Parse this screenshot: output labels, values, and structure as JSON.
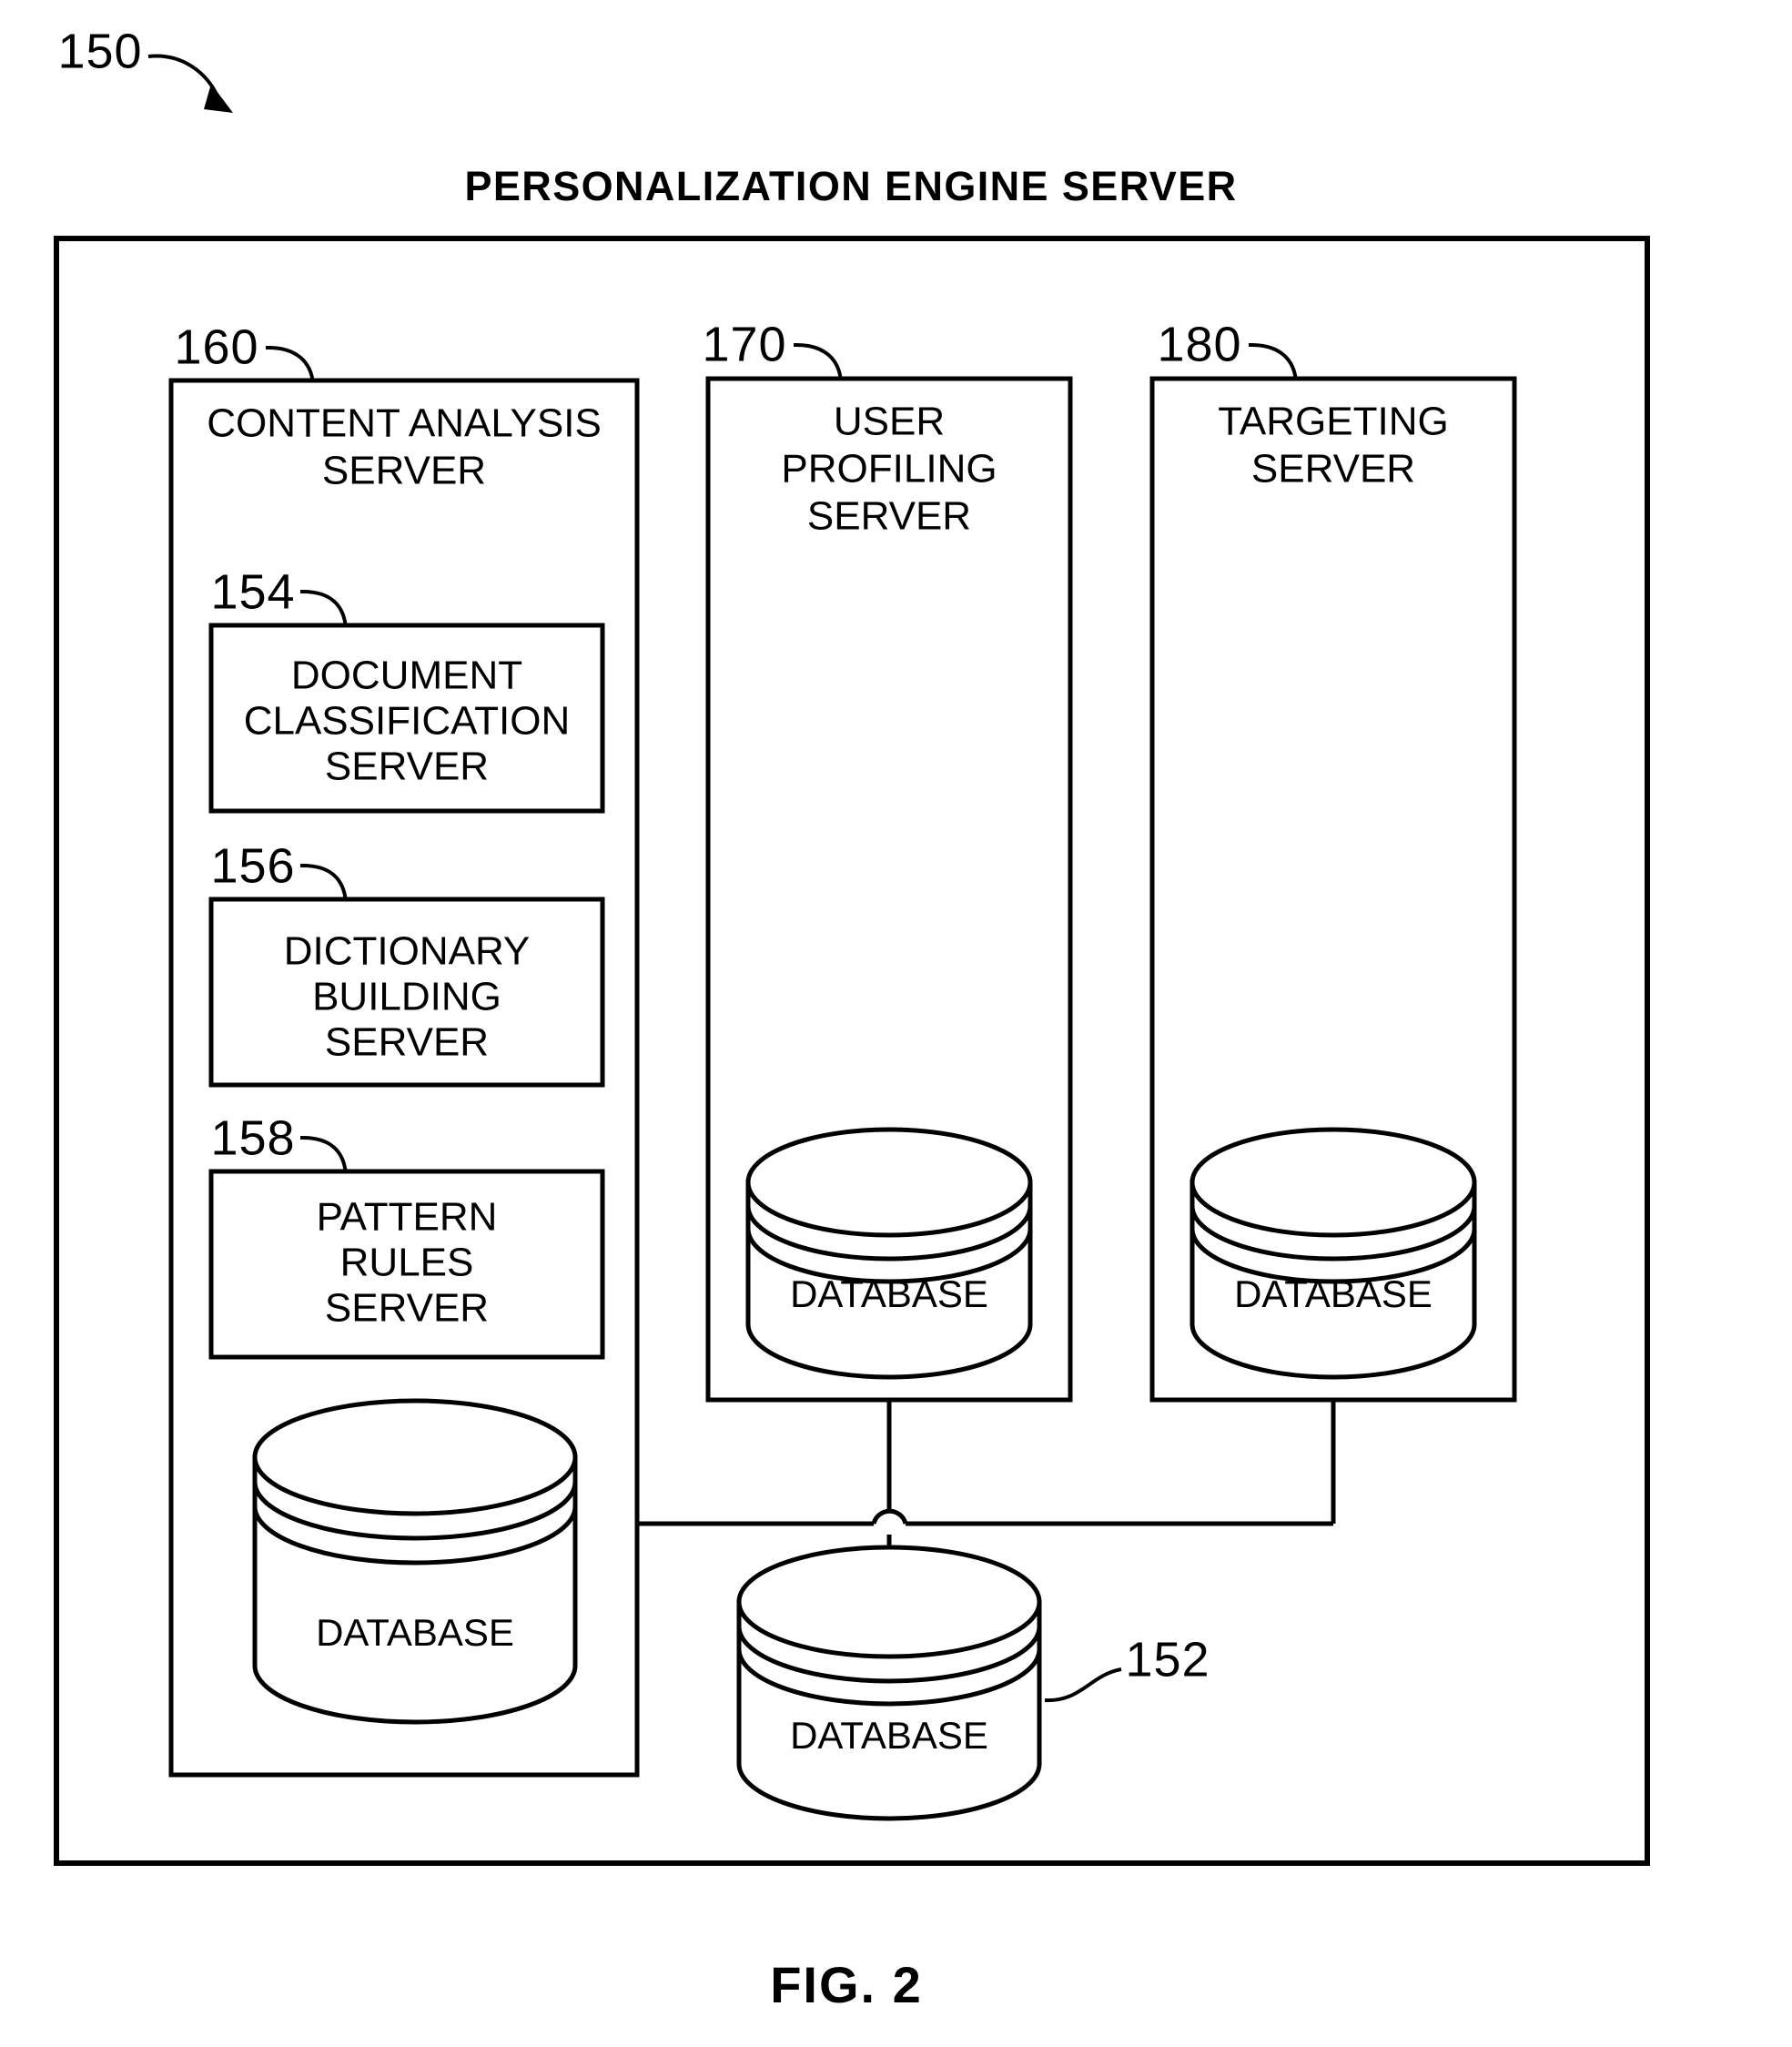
{
  "figure": {
    "caption": "FIG. 2",
    "top_reference_numeral": "150",
    "title": "PERSONALIZATION ENGINE SERVER"
  },
  "columns": [
    {
      "id": "content-analysis-server",
      "reference_numeral": "160",
      "label_lines": [
        "CONTENT ANALYSIS",
        "SERVER"
      ],
      "modules": [
        {
          "id": "document-classification-server",
          "reference_numeral": "154",
          "label_lines": [
            "DOCUMENT",
            "CLASSIFICATION",
            "SERVER"
          ]
        },
        {
          "id": "dictionary-building-server",
          "reference_numeral": "156",
          "label_lines": [
            "DICTIONARY",
            "BUILDING",
            "SERVER"
          ]
        },
        {
          "id": "pattern-rules-server",
          "reference_numeral": "158",
          "label_lines": [
            "PATTERN",
            "RULES",
            "SERVER"
          ]
        }
      ],
      "database": {
        "id": "content-analysis-database",
        "label": "DATABASE"
      }
    },
    {
      "id": "user-profiling-server",
      "reference_numeral": "170",
      "label_lines": [
        "USER",
        "PROFILING",
        "SERVER"
      ],
      "modules": [],
      "database": {
        "id": "user-profiling-database",
        "label": "DATABASE"
      }
    },
    {
      "id": "targeting-server",
      "reference_numeral": "180",
      "label_lines": [
        "TARGETING",
        "SERVER"
      ],
      "modules": [],
      "database": {
        "id": "targeting-database",
        "label": "DATABASE"
      }
    }
  ],
  "shared_database": {
    "id": "shared-database",
    "reference_numeral": "152",
    "label": "DATABASE"
  },
  "colors": {
    "line": "#000000",
    "background": "#ffffff",
    "text": "#000000"
  }
}
